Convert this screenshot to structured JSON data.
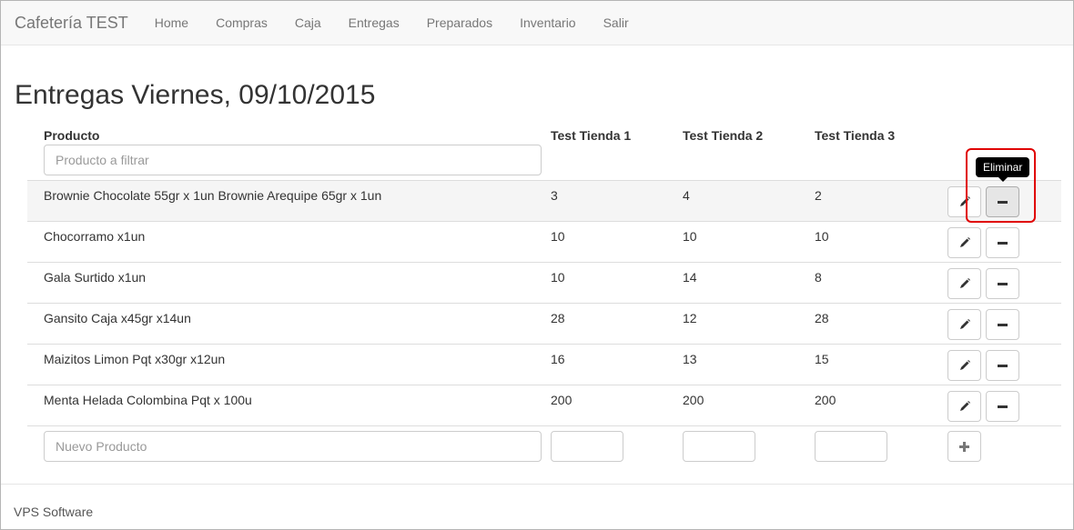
{
  "navbar": {
    "brand": "Cafetería TEST",
    "links": [
      "Home",
      "Compras",
      "Caja",
      "Entregas",
      "Preparados",
      "Inventario",
      "Salir"
    ]
  },
  "page": {
    "title": "Entregas Viernes, 09/10/2015"
  },
  "table": {
    "headers": [
      "Producto",
      "Test Tienda 1",
      "Test Tienda 2",
      "Test Tienda 3"
    ],
    "filter_placeholder": "Producto a filtrar",
    "rows": [
      {
        "product": "Brownie Chocolate 55gr x 1un Brownie Arequipe 65gr x 1un",
        "t1": "3",
        "t2": "4",
        "t3": "2"
      },
      {
        "product": "Chocorramo x1un",
        "t1": "10",
        "t2": "10",
        "t3": "10"
      },
      {
        "product": "Gala Surtido x1un",
        "t1": "10",
        "t2": "14",
        "t3": "8"
      },
      {
        "product": "Gansito Caja x45gr x14un",
        "t1": "28",
        "t2": "12",
        "t3": "28"
      },
      {
        "product": "Maizitos Limon Pqt x30gr x12un",
        "t1": "16",
        "t2": "13",
        "t3": "15"
      },
      {
        "product": "Menta Helada Colombina Pqt x 100u",
        "t1": "200",
        "t2": "200",
        "t3": "200"
      }
    ],
    "new_product_placeholder": "Nuevo Producto"
  },
  "tooltip": {
    "text": "Eliminar"
  },
  "footer": {
    "text": "VPS Software"
  },
  "colors": {
    "navbar_bg": "#f8f8f8",
    "highlight": "#e00000",
    "row_hover": "#f5f5f5"
  },
  "icons": {
    "edit": "pencil-icon",
    "delete": "minus-icon",
    "add": "plus-icon"
  }
}
